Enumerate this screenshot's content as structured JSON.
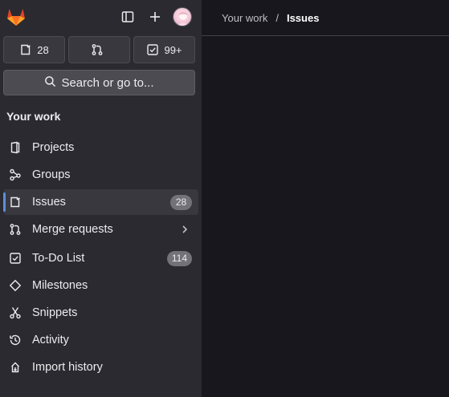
{
  "header": {
    "avatar_alt": "User avatar"
  },
  "counters": {
    "issues": "28",
    "merge_requests": "",
    "todos": "99+"
  },
  "search": {
    "label": "Search or go to..."
  },
  "section": {
    "title": "Your work"
  },
  "nav": {
    "items": [
      {
        "label": "Projects",
        "icon": "project-icon",
        "badge": ""
      },
      {
        "label": "Groups",
        "icon": "group-icon",
        "badge": ""
      },
      {
        "label": "Issues",
        "icon": "issues-icon",
        "badge": "28"
      },
      {
        "label": "Merge requests",
        "icon": "merge-request-icon",
        "badge": ""
      },
      {
        "label": "To-Do List",
        "icon": "todo-icon",
        "badge": "114"
      },
      {
        "label": "Milestones",
        "icon": "milestone-icon",
        "badge": ""
      },
      {
        "label": "Snippets",
        "icon": "snippet-icon",
        "badge": ""
      },
      {
        "label": "Activity",
        "icon": "history-icon",
        "badge": ""
      },
      {
        "label": "Import history",
        "icon": "import-icon",
        "badge": ""
      }
    ]
  },
  "breadcrumb": {
    "parent": "Your work",
    "separator": "/",
    "current": "Issues"
  },
  "colors": {
    "sidebar_bg": "#2b2a30",
    "main_bg": "#18171d",
    "active_indicator": "#5b8fd9",
    "badge_bg": "#737278"
  }
}
